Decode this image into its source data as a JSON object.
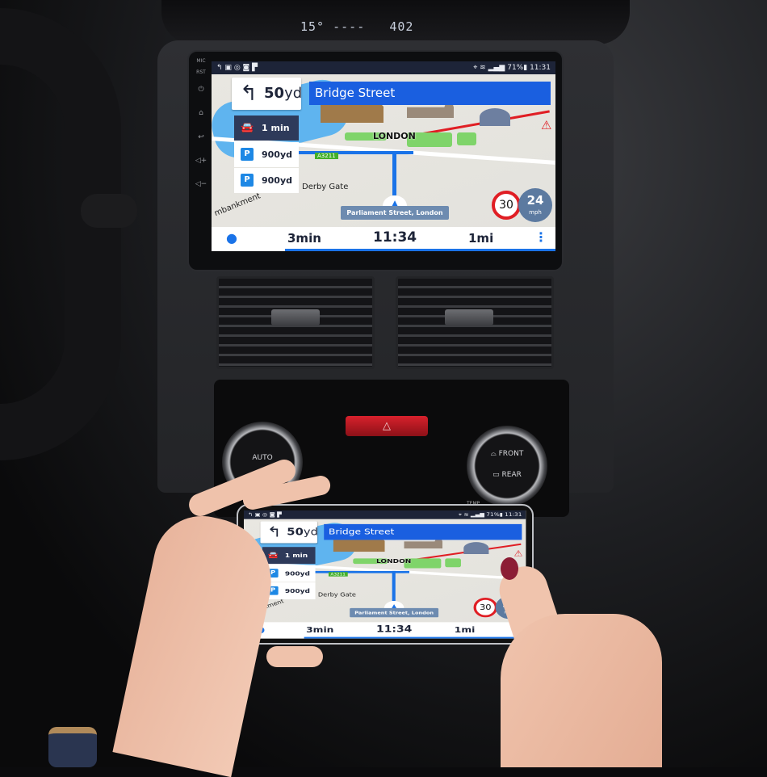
{
  "dashboard": {
    "readout_temp": "15°",
    "readout_dots": "----",
    "readout_value": "402",
    "hazard_icon": "hazard-triangle-icon",
    "knob_left_label": "AUTO",
    "knob_right_front": "FRONT",
    "knob_right_rear": "REAR",
    "temp_label": "TEMP"
  },
  "head_unit": {
    "side_buttons": [
      "MIC",
      "RST"
    ],
    "side_icons": [
      "power-icon",
      "home-icon",
      "back-icon",
      "volume-up-icon",
      "volume-down-icon"
    ]
  },
  "status_bar": {
    "left_icons": [
      "navigation-icon",
      "gallery-icon",
      "app-icon",
      "chat-icon",
      "flipboard-icon"
    ],
    "battery": "71%",
    "time": "11:31"
  },
  "navigation": {
    "turn": {
      "icon": "turn-left-arrow-icon",
      "distance_value": "50",
      "distance_unit": "yd"
    },
    "street": "Bridge Street",
    "traffic": {
      "icon": "traffic-car-icon",
      "label": "1 min"
    },
    "parking": [
      {
        "icon": "parking-icon",
        "label": "900yd"
      },
      {
        "icon": "parking-garage-icon",
        "label": "900yd"
      }
    ],
    "map_labels": {
      "city": "LONDON",
      "road": "A3211",
      "derby": "Derby Gate",
      "embankment": "mbankment"
    },
    "speed_limit": "30",
    "current_speed": "24",
    "speed_unit": "mph",
    "current_location": "Parliament Street, London",
    "bottom": {
      "eta_remaining": "3min",
      "arrival": "11:34",
      "distance": "1mi"
    },
    "colors": {
      "accent": "#1a5fe0",
      "navy": "#1d2438",
      "limit": "#e01e24"
    }
  }
}
